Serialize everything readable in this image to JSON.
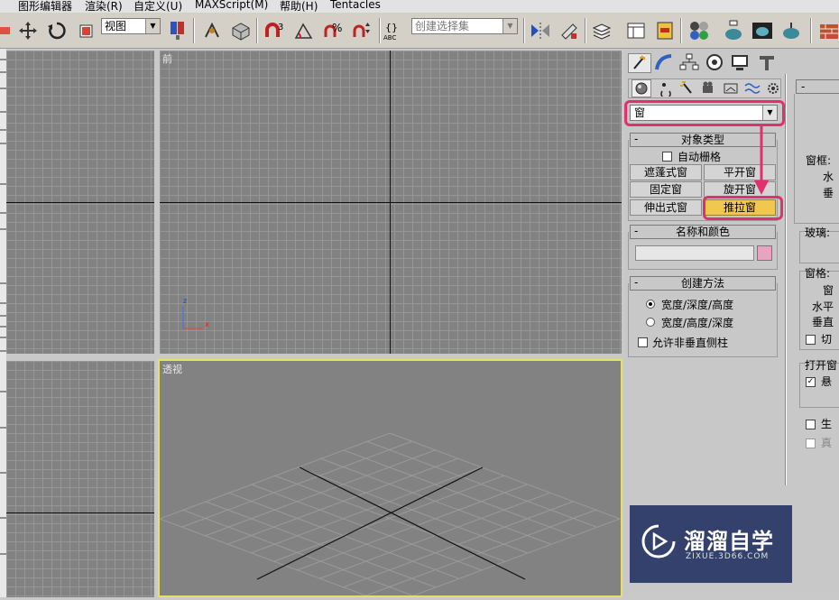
{
  "menu": [
    "图形编辑器",
    "渲染(R)",
    "自定义(U)",
    "MAXScript(M)",
    "帮助(H)",
    "Tentacles"
  ],
  "toolbar": {
    "reference_coord": "视图",
    "named_selection_placeholder": "创建选择集"
  },
  "viewports": {
    "front_label": "前",
    "perspective_label": "透视",
    "axis_z": "z",
    "axis_x": "x"
  },
  "command_panel": {
    "category_dropdown": "窗",
    "object_type": {
      "title": "对象类型",
      "autogrid_label": "自动栅格",
      "buttons": [
        "遮蓬式窗",
        "平开窗",
        "固定窗",
        "旋开窗",
        "伸出式窗",
        "推拉窗"
      ],
      "selected": "推拉窗"
    },
    "name_color": {
      "title": "名称和颜色",
      "name_value": "",
      "color": "#e8a3c0"
    },
    "creation_method": {
      "title": "创建方法",
      "options": [
        "宽度/深度/高度",
        "宽度/高度/深度"
      ],
      "selected_index": 0,
      "allow_non_vertical_label": "允许非垂直侧柱"
    }
  },
  "parameters_panel": {
    "window_frame_label": "窗框:",
    "horizontal_label": "水",
    "vertical_label": "垂",
    "glass_label": "玻璃:",
    "rails_label": "窗格:",
    "rail_width": "窗",
    "horizontal_rails": "水平",
    "vertical_rails": "垂直",
    "chamfer_label": "切",
    "open_window_label": "打开窗",
    "hung_label": "悬",
    "gen_mapping_label": "生",
    "real_world_label": "真"
  },
  "watermark": {
    "name": "溜溜自学",
    "url": "ZIXUE.3D66.COM"
  },
  "colors": {
    "highlight": "#e0306e",
    "selected_button": "#f0c850",
    "active_viewport_border": "#e8e060"
  }
}
